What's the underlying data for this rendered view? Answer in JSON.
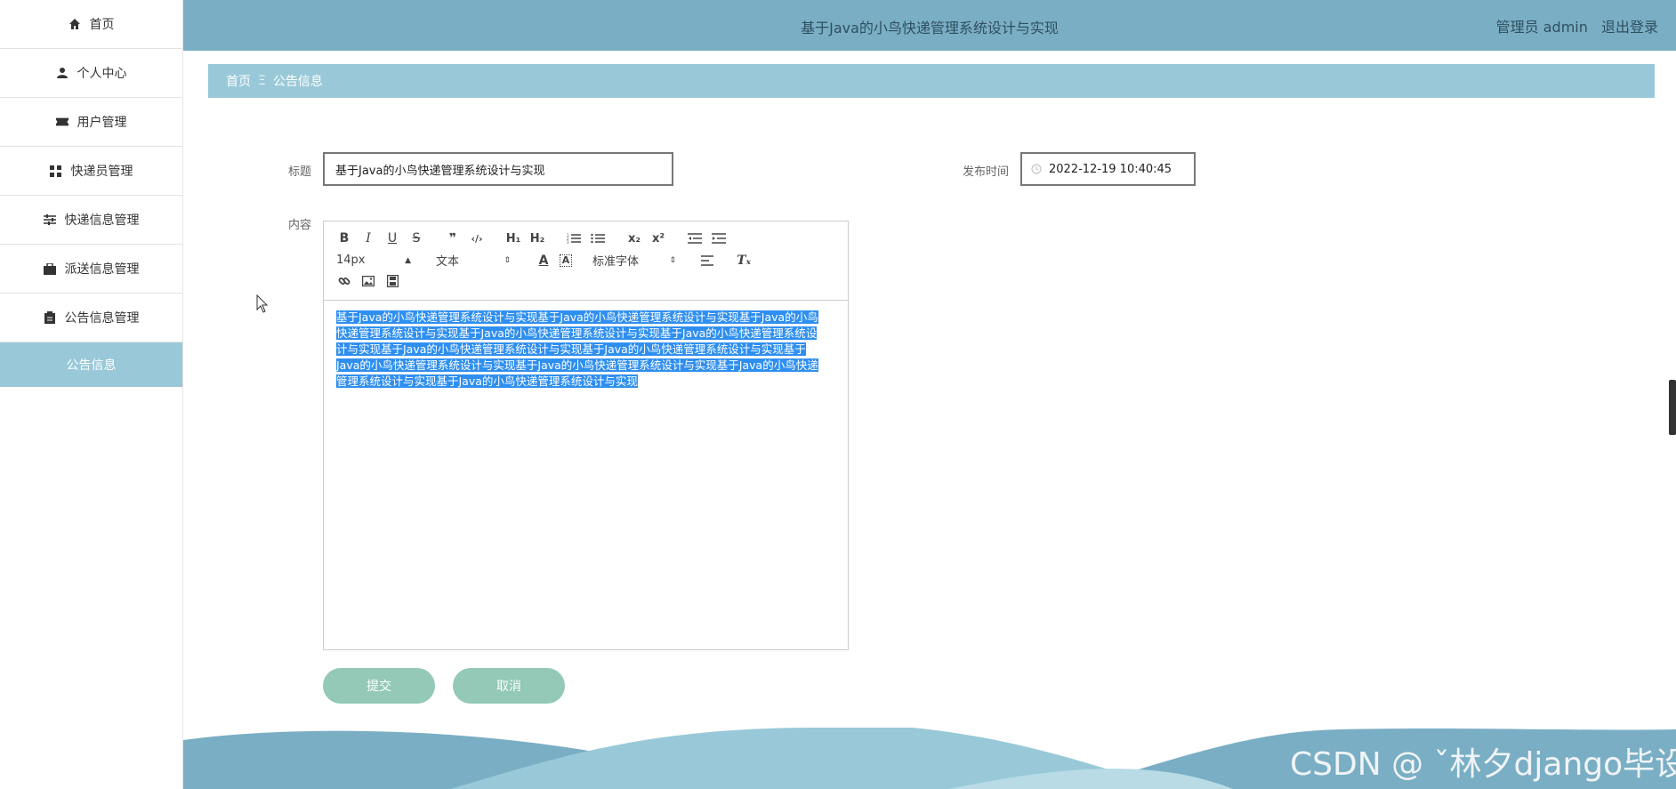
{
  "sidebar": {
    "items": [
      {
        "label": "首页",
        "icon": "home-icon"
      },
      {
        "label": "个人中心",
        "icon": "user-icon"
      },
      {
        "label": "用户管理",
        "icon": "ticket-icon"
      },
      {
        "label": "快递员管理",
        "icon": "grid-icon"
      },
      {
        "label": "快递信息管理",
        "icon": "sliders-icon"
      },
      {
        "label": "派送信息管理",
        "icon": "briefcase-icon"
      },
      {
        "label": "公告信息管理",
        "icon": "clipboard-icon"
      },
      {
        "label": "公告信息",
        "icon": ""
      }
    ],
    "active_index": 7
  },
  "header": {
    "title": "基于Java的小鸟快递管理系统设计与实现",
    "user": "管理员 admin",
    "logout": "退出登录"
  },
  "breadcrumb": {
    "home": "首页",
    "separator": "Ξ",
    "current": "公告信息"
  },
  "form": {
    "title_label": "标题",
    "title_value": "基于Java的小鸟快递管理系统设计与实现",
    "time_label": "发布时间",
    "time_value": "2022-12-19 10:40:45",
    "content_label": "内容",
    "content_lines": [
      "基于Java的小鸟快递管理系统设计与实现基于Java的小鸟快递管理系统设计与实现基于Java的小鸟",
      "快递管理系统设计与实现基于Java的小鸟快递管理系统设计与实现基于Java的小鸟快递管理系统设",
      "计与实现基于Java的小鸟快递管理系统设计与实现基于Java的小鸟快递管理系统设计与实现基于",
      "Java的小鸟快递管理系统设计与实现基于Java的小鸟快递管理系统设计与实现基于Java的小鸟快递",
      "管理系统设计与实现基于Java的小鸟快递管理系统设计与实现"
    ]
  },
  "toolbar": {
    "font_size": "14px",
    "header_select": "文本",
    "font_family": "标准字体"
  },
  "buttons": {
    "submit": "提交",
    "cancel": "取消"
  },
  "watermark": "CSDN @ ˇ林夕django毕设",
  "colors": {
    "header": "#7aaec4",
    "breadcrumb": "#99c9d8",
    "active_sidebar": "#99c9d8",
    "button": "#93c9b6",
    "selection": "#2f8ff0"
  }
}
